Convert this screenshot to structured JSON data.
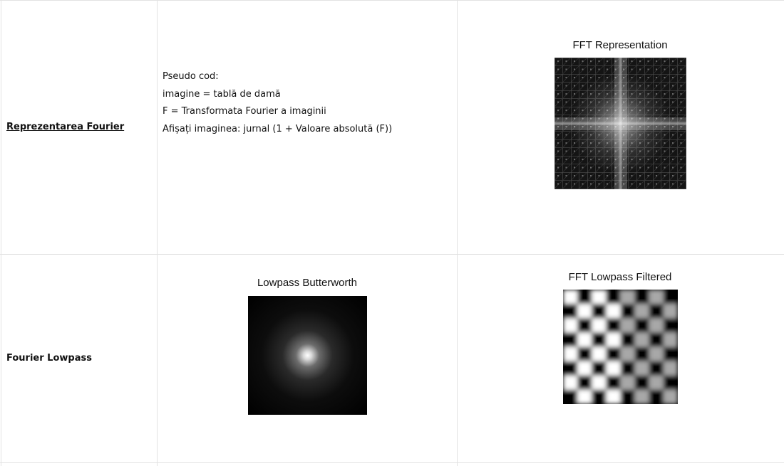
{
  "rows": [
    {
      "label": "Reprezentarea Fourier",
      "pseudo": {
        "lines": [
          "Pseudo cod:",
          "imagine = tablă de damă",
          "",
          "F = Transformata Fourier a imaginii",
          "",
          "Afișați imaginea: jurnal (1 + Valoare absolută (F))"
        ]
      },
      "figure": {
        "title": "FFT Representation"
      }
    },
    {
      "label": "Fourier Lowpass",
      "figure_mid": {
        "title": "Lowpass Butterworth"
      },
      "figure": {
        "title": "FFT Lowpass Filtered"
      }
    }
  ],
  "colors": {
    "grid_line": "#e2e2e2",
    "text": "#111111",
    "background": "#ffffff"
  }
}
